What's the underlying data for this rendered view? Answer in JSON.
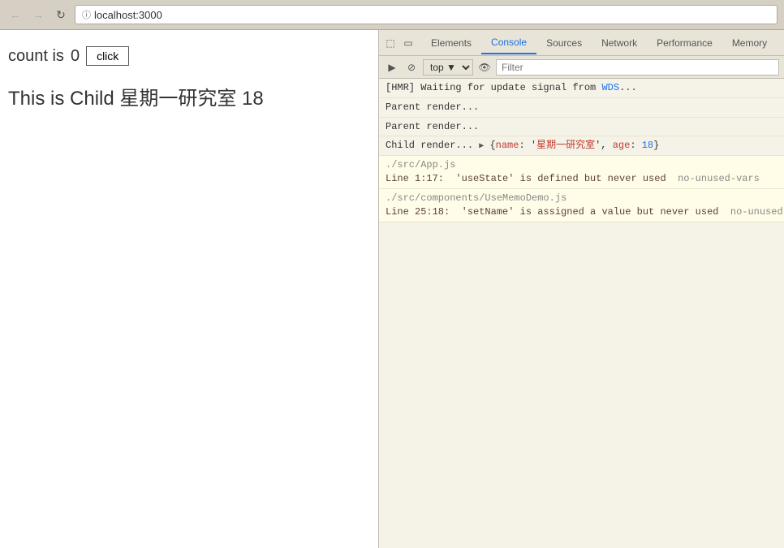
{
  "browser": {
    "url": "localhost:3000",
    "back_label": "←",
    "forward_label": "→",
    "refresh_label": "↻"
  },
  "page": {
    "count_label": "count is",
    "count_value": "0",
    "click_button_label": "click",
    "child_label": "This is Child 星期一研究室 18"
  },
  "devtools": {
    "tabs": [
      {
        "label": "Elements",
        "active": false
      },
      {
        "label": "Console",
        "active": true
      },
      {
        "label": "Sources",
        "active": false
      },
      {
        "label": "Network",
        "active": false
      },
      {
        "label": "Performance",
        "active": false
      },
      {
        "label": "Memory",
        "active": false
      }
    ],
    "secondary": {
      "context": "top ▼",
      "filter_placeholder": "Filter"
    },
    "messages": [
      {
        "type": "hmr",
        "text": "[HMR] Waiting for update signal from WDS..."
      },
      {
        "type": "parent",
        "text": "Parent render..."
      },
      {
        "type": "parent",
        "text": "Parent render..."
      },
      {
        "type": "child",
        "text": "Child render..."
      },
      {
        "type": "warning",
        "file": "./src/App.js",
        "line": "Line 1:17:",
        "message": "'useState' is defined but never used",
        "rule": "no-unused-vars"
      },
      {
        "type": "warning",
        "file": "./src/components/UseMemoDemo.js",
        "line": "Line 25:18:",
        "message": "'setName' is assigned a value but never used",
        "rule": "no-unused-va..."
      }
    ]
  }
}
